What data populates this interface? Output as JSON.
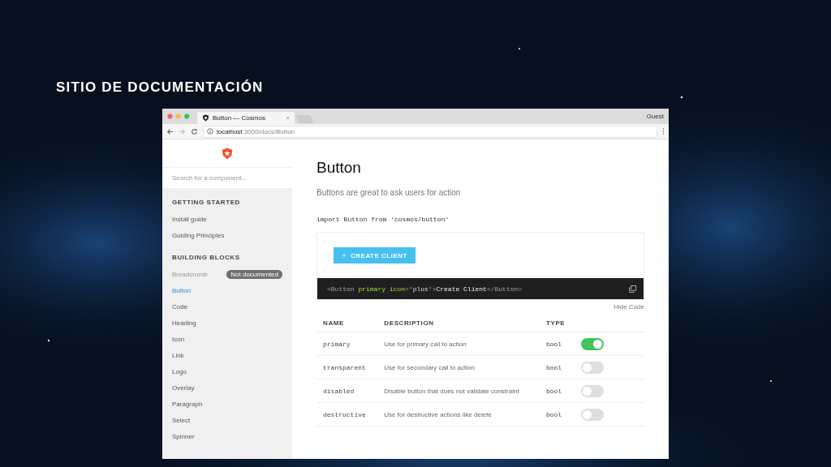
{
  "slide": {
    "title": "SITIO DE DOCUMENTACIÓN"
  },
  "browser": {
    "tab_title": "Button — Cosmos",
    "profile": "Guest",
    "url_host": "localhost",
    "url_path": ":3000/docs/Button"
  },
  "sidebar": {
    "search": {
      "placeholder": "Search for a component..."
    },
    "sections": [
      {
        "heading": "GETTING STARTED",
        "items": [
          {
            "label": "Install guide",
            "selected": false,
            "disabled": false
          },
          {
            "label": "Guiding Principles",
            "selected": false,
            "disabled": false
          }
        ]
      },
      {
        "heading": "BUILDING BLOCKS",
        "items": [
          {
            "label": "Breadcrumb",
            "selected": false,
            "disabled": true,
            "badge": "Not documented"
          },
          {
            "label": "Button",
            "selected": true,
            "disabled": false
          },
          {
            "label": "Code",
            "selected": false,
            "disabled": false
          },
          {
            "label": "Heading",
            "selected": false,
            "disabled": false
          },
          {
            "label": "Icon",
            "selected": false,
            "disabled": false
          },
          {
            "label": "Link",
            "selected": false,
            "disabled": false
          },
          {
            "label": "Logo",
            "selected": false,
            "disabled": false
          },
          {
            "label": "Overlay",
            "selected": false,
            "disabled": false
          },
          {
            "label": "Paragraph",
            "selected": false,
            "disabled": false
          },
          {
            "label": "Select",
            "selected": false,
            "disabled": false
          },
          {
            "label": "Spinner",
            "selected": false,
            "disabled": false
          }
        ]
      }
    ]
  },
  "main": {
    "title": "Button",
    "subtitle": "Buttons are great to ask users for action",
    "import_code": "import Button from 'cosmos/button'",
    "demo_button": "CREATE CLIENT",
    "code": [
      {
        "text": "<Button ",
        "kind": "tag"
      },
      {
        "text": "primary icon",
        "kind": "attr"
      },
      {
        "text": "=",
        "kind": "punct"
      },
      {
        "text": "'plus'",
        "kind": "string"
      },
      {
        "text": ">",
        "kind": "punct"
      },
      {
        "text": "Create Client",
        "kind": "text"
      },
      {
        "text": "</Button>",
        "kind": "tag"
      }
    ],
    "hide_code": "Hide Code",
    "table": {
      "columns": [
        "NAME",
        "DESCRIPTION",
        "TYPE"
      ],
      "rows": [
        {
          "name": "primary",
          "description": "Use for primary call to action",
          "type": "bool",
          "on": true
        },
        {
          "name": "transparent",
          "description": "Use for secondary call to action",
          "type": "bool",
          "on": false
        },
        {
          "name": "disabled",
          "description": "Disable button that does not validate constraint",
          "type": "bool",
          "on": false
        },
        {
          "name": "destructive",
          "description": "Use for destructive actions like delete",
          "type": "bool",
          "on": false
        }
      ]
    }
  }
}
